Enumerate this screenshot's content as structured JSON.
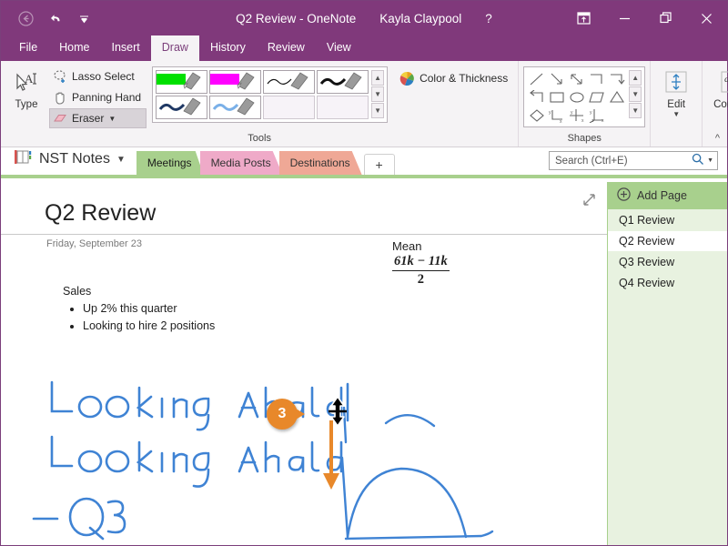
{
  "window": {
    "title": "Q2 Review - OneNote",
    "user": "Kayla Claypool",
    "help_label": "?",
    "qat": [
      {
        "name": "back-icon",
        "label": "Back"
      },
      {
        "name": "undo-icon",
        "label": "Undo"
      },
      {
        "name": "customize-qat-icon",
        "label": "Customize Quick Access Toolbar"
      }
    ],
    "controls": [
      {
        "name": "ribbon-display-options-icon",
        "label": "Ribbon Display Options"
      },
      {
        "name": "minimize-icon",
        "label": "Minimize"
      },
      {
        "name": "restore-icon",
        "label": "Restore Down"
      },
      {
        "name": "close-icon",
        "label": "Close"
      }
    ],
    "accent_color": "#80397b"
  },
  "ribbon": {
    "tabs": [
      {
        "label": "File",
        "active": false
      },
      {
        "label": "Home",
        "active": false
      },
      {
        "label": "Insert",
        "active": false
      },
      {
        "label": "Draw",
        "active": true
      },
      {
        "label": "History",
        "active": false
      },
      {
        "label": "Review",
        "active": false
      },
      {
        "label": "View",
        "active": false
      }
    ],
    "groups": {
      "tools": {
        "label": "Tools",
        "type_button": "Type",
        "lasso_select": "Lasso Select",
        "panning_hand": "Panning Hand",
        "eraser": "Eraser",
        "pens": [
          {
            "name": "highlighter-green",
            "color": "#00e000",
            "kind": "highlighter"
          },
          {
            "name": "highlighter-magenta",
            "color": "#ff00ff",
            "kind": "highlighter"
          },
          {
            "name": "pen-black-thin",
            "color": "#111111",
            "kind": "pen-thin"
          },
          {
            "name": "pen-black-thick",
            "color": "#111111",
            "kind": "pen-thick"
          },
          {
            "name": "pen-navy",
            "color": "#1f3864",
            "kind": "pen-thick"
          },
          {
            "name": "pen-light-blue",
            "color": "#7ab0e8",
            "kind": "pen-thick"
          },
          {
            "name": "pen-empty-1",
            "color": "",
            "kind": "empty"
          },
          {
            "name": "pen-empty-2",
            "color": "",
            "kind": "empty"
          }
        ],
        "color_thickness": "Color & Thickness"
      },
      "shapes": {
        "label": "Shapes",
        "items": [
          "line",
          "arrow-down-right",
          "arrow-double",
          "elbow-connector",
          "elbow-arrow-down",
          "elbow-arrow-left",
          "rectangle",
          "ellipse",
          "parallelogram",
          "triangle",
          "diamond",
          "axis-xy",
          "axis-quadrant",
          "axis-xyz"
        ]
      },
      "edit": {
        "label": "Edit",
        "icon": "edit-resize-icon"
      },
      "convert": {
        "label": "Convert",
        "icon": "convert-ink-to-text-icon"
      }
    },
    "collapse_label": "Collapse the Ribbon"
  },
  "notebook": {
    "name": "NST Notes",
    "sections": [
      {
        "label": "Meetings",
        "color": "#a8d08d",
        "active": true
      },
      {
        "label": "Media Posts",
        "color": "#efaac8",
        "active": false
      },
      {
        "label": "Destinations",
        "color": "#efa896",
        "active": false
      }
    ],
    "add_section_label": "+"
  },
  "search": {
    "placeholder": "Search (Ctrl+E)",
    "value": ""
  },
  "page": {
    "title": "Q2 Review",
    "date": "Friday, September 23",
    "expand_icon": "expand-page-icon",
    "sections": [
      {
        "heading": "Sales",
        "bullets": [
          "Up 2% this quarter",
          "Looking to hire 2 positions"
        ]
      }
    ],
    "math": {
      "label": "Mean",
      "numerator": "61k − 11k",
      "denominator": "2"
    },
    "ink": {
      "line1": "Looking Ahead",
      "line2": "Looking Ahead",
      "line3": "- Q3",
      "color": "#3f83d4",
      "drawing": "hand-drawn-parabola-with-axes"
    }
  },
  "callout": {
    "step_number": "3",
    "color": "#e8882a"
  },
  "page_list": {
    "add_page_label": "Add Page",
    "pages": [
      {
        "label": "Q1 Review",
        "active": false
      },
      {
        "label": "Q2 Review",
        "active": true
      },
      {
        "label": "Q3 Review",
        "active": false
      },
      {
        "label": "Q4 Review",
        "active": false
      }
    ]
  }
}
